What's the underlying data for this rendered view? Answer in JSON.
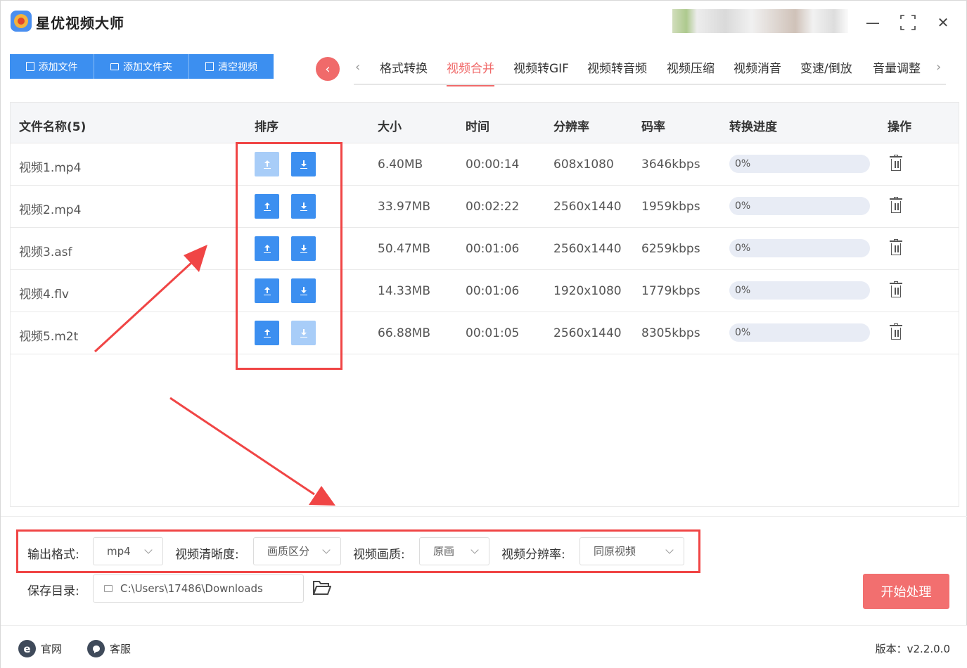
{
  "app": {
    "title": "星优视频大师",
    "window_controls": {
      "minimize": "—",
      "maximize": "⛶",
      "close": "✕"
    }
  },
  "toolbar": {
    "add_file": "添加文件",
    "add_folder": "添加文件夹",
    "clear_videos": "清空视频"
  },
  "tabs": {
    "back": "‹",
    "prev": "‹",
    "next": "›",
    "items": [
      "格式转换",
      "视频合并",
      "视频转GIF",
      "视频转音频",
      "视频压缩",
      "视频消音",
      "变速/倒放",
      "音量调整"
    ],
    "active_index": 1
  },
  "table": {
    "headers": {
      "name": "文件名称(5)",
      "order": "排序",
      "size": "大小",
      "time": "时间",
      "resolution": "分辨率",
      "bitrate": "码率",
      "progress": "转换进度",
      "action": "操作"
    },
    "rows": [
      {
        "name": "视频1.mp4",
        "size": "6.40MB",
        "time": "00:00:14",
        "resolution": "608x1080",
        "bitrate": "3646kbps",
        "progress": "0%",
        "progress_value": 0,
        "up_enabled": false,
        "down_enabled": true
      },
      {
        "name": "视频2.mp4",
        "size": "33.97MB",
        "time": "00:02:22",
        "resolution": "2560x1440",
        "bitrate": "1959kbps",
        "progress": "0%",
        "progress_value": 0,
        "up_enabled": true,
        "down_enabled": true
      },
      {
        "name": "视频3.asf",
        "size": "50.47MB",
        "time": "00:01:06",
        "resolution": "2560x1440",
        "bitrate": "6259kbps",
        "progress": "0%",
        "progress_value": 0,
        "up_enabled": true,
        "down_enabled": true
      },
      {
        "name": "视频4.flv",
        "size": "14.33MB",
        "time": "00:01:06",
        "resolution": "1920x1080",
        "bitrate": "1779kbps",
        "progress": "0%",
        "progress_value": 0,
        "up_enabled": true,
        "down_enabled": true
      },
      {
        "name": "视频5.m2t",
        "size": "66.88MB",
        "time": "00:01:05",
        "resolution": "2560x1440",
        "bitrate": "8305kbps",
        "progress": "0%",
        "progress_value": 0,
        "up_enabled": true,
        "down_enabled": false
      }
    ]
  },
  "settings": {
    "output_format_label": "输出格式:",
    "output_format_value": "mp4",
    "clarity_label": "视频清晰度:",
    "clarity_value": "画质区分",
    "quality_label": "视频画质:",
    "quality_value": "原画",
    "resolution_label": "视频分辨率:",
    "resolution_value": "同原视频",
    "save_dir_label": "保存目录:",
    "save_dir_value": "C:\\Users\\17486\\Downloads",
    "start_button": "开始处理"
  },
  "footer": {
    "website_icon": "e",
    "website": "官网",
    "support": "客服",
    "version": "版本：v2.2.0.0"
  },
  "colors": {
    "accent_blue": "#3c8ff0",
    "accent_red": "#f06a6a",
    "annotation_red": "#f04545"
  }
}
